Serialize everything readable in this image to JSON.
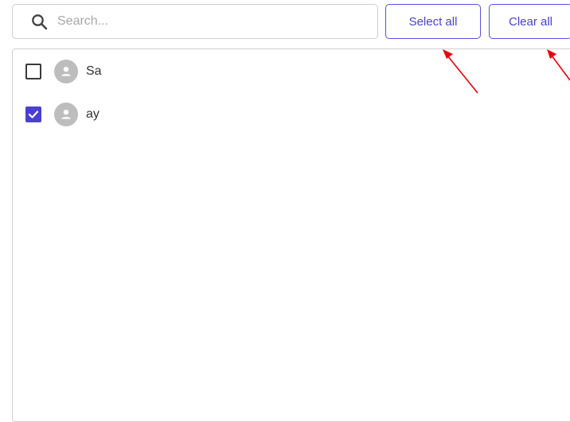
{
  "search": {
    "placeholder": "Search...",
    "value": ""
  },
  "buttons": {
    "select_all": "Select all",
    "clear_all": "Clear all"
  },
  "users": [
    {
      "name": "Sa",
      "checked": false
    },
    {
      "name": "ay",
      "checked": true
    }
  ],
  "colors": {
    "accent": "#4a3fd4",
    "annotation_arrow": "#e8000b",
    "avatar": "#bdbdbd"
  }
}
